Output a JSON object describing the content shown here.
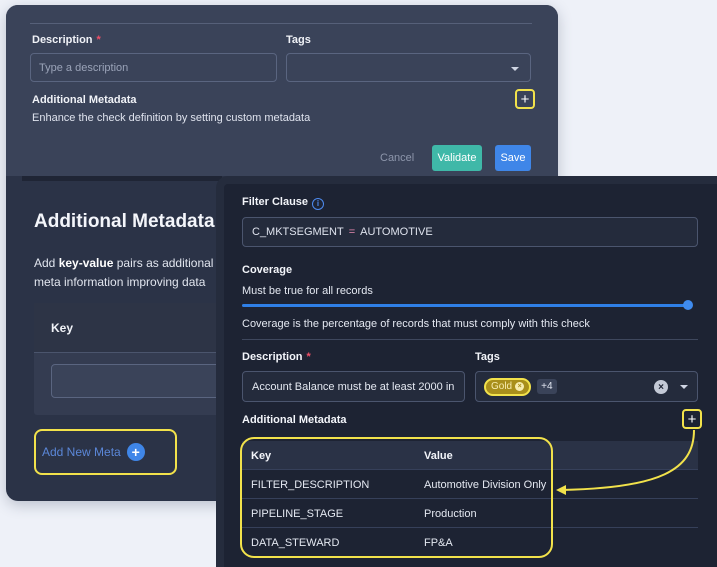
{
  "back_form": {
    "description_label": "Description",
    "required_mark": "*",
    "description_placeholder": "Type a description",
    "tags_label": "Tags",
    "additional_metadata_label": "Additional Metadata",
    "metadata_hint": "Enhance the check definition by setting custom metadata",
    "cancel_label": "Cancel",
    "validate_label": "Validate",
    "save_label": "Save"
  },
  "metadata_panel": {
    "title": "Additional Metadata",
    "desc_prefix": "Add ",
    "desc_bold": "key-value",
    "desc_line1_rest": " pairs as additional",
    "desc_line2": "meta information improving data",
    "key_header": "Key",
    "add_new_meta_label": "Add New Meta"
  },
  "check_form": {
    "filter_clause_label": "Filter Clause",
    "filter_left": "C_MKTSEGMENT",
    "filter_op": "=",
    "filter_right": "AUTOMOTIVE",
    "coverage_label": "Coverage",
    "coverage_mode": "Must be true for all records",
    "coverage_value": 1.0,
    "coverage_hint": "Coverage is the percentage of records that must comply with this check",
    "description_label": "Description",
    "required_mark": "*",
    "description_value": "Account Balance must be at least 2000 in",
    "tags_label": "Tags",
    "tag_gold": "Gold",
    "tag_more": "+4",
    "additional_metadata_label": "Additional Metadata",
    "table_headers": {
      "key": "Key",
      "value": "Value"
    },
    "rows": [
      {
        "key": "FILTER_DESCRIPTION",
        "value": "Automotive Division Only"
      },
      {
        "key": "PIPELINE_STAGE",
        "value": "Production"
      },
      {
        "key": "DATA_STEWARD",
        "value": "FP&A"
      }
    ]
  },
  "colors": {
    "highlight": "#f2e24b",
    "accent_blue": "#3f86e8",
    "validate_teal": "#3fb8a8",
    "required_red": "#ef4f67"
  }
}
